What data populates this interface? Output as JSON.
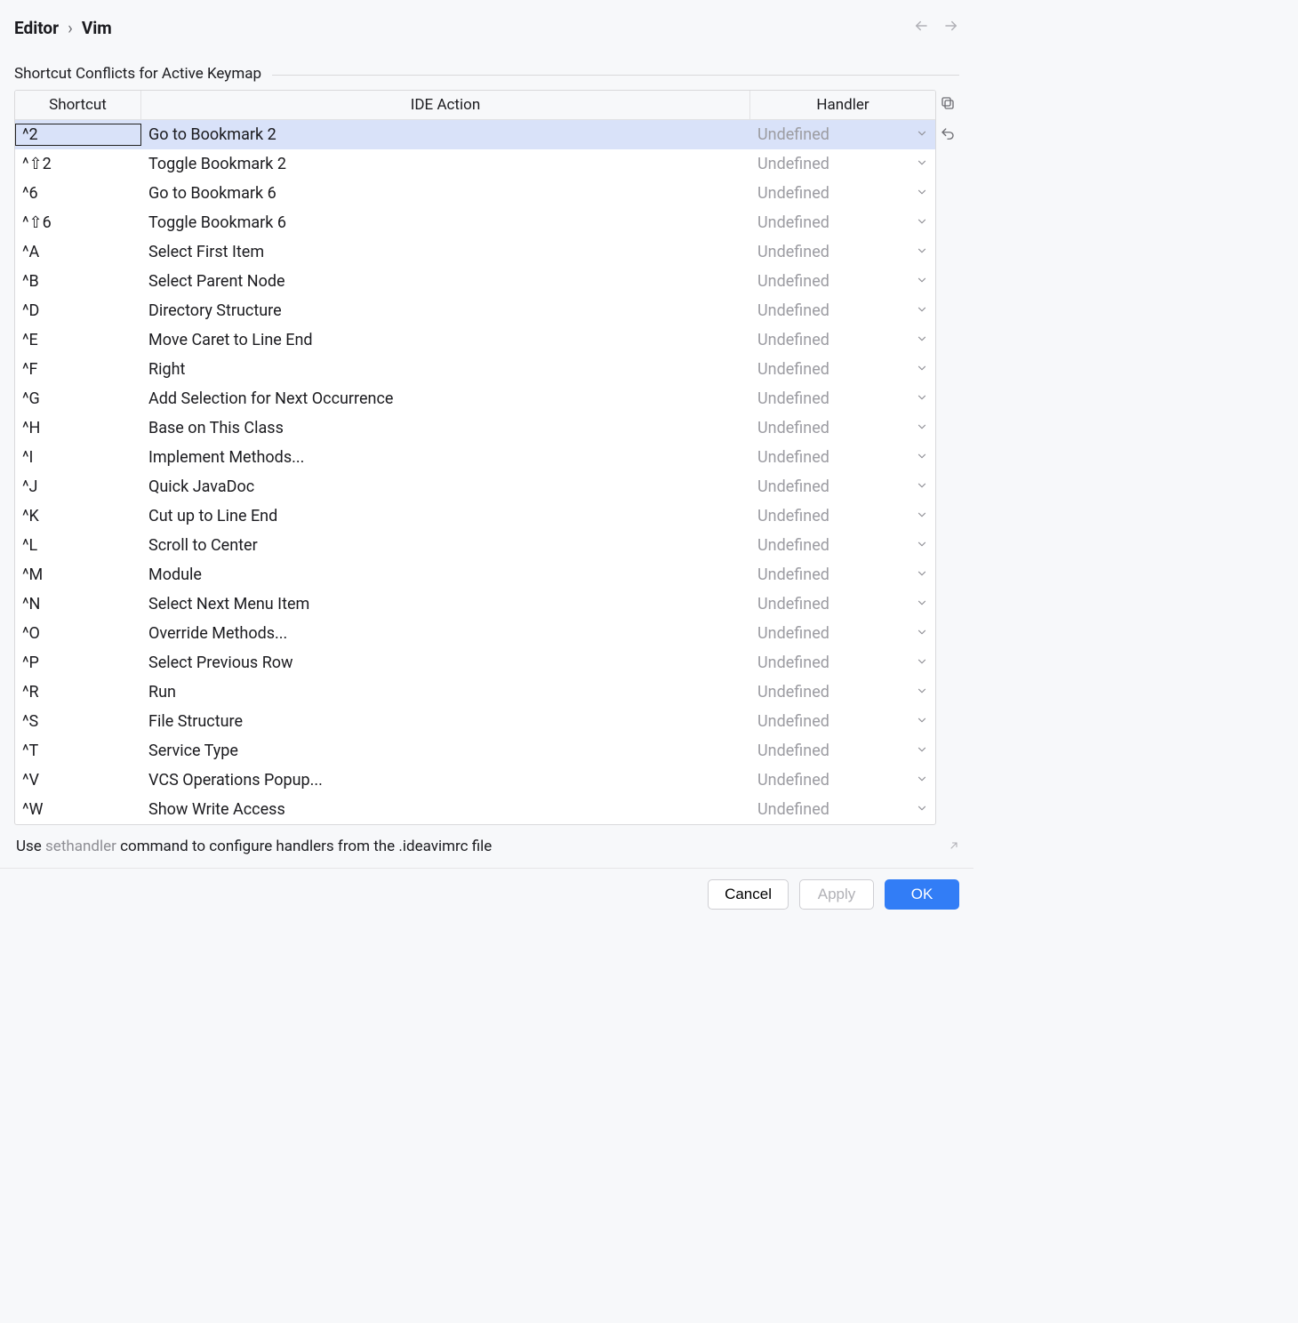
{
  "breadcrumb": {
    "parent": "Editor",
    "sep": "›",
    "current": "Vim"
  },
  "section_title": "Shortcut Conflicts for Active Keymap",
  "columns": {
    "shortcut": "Shortcut",
    "action": "IDE Action",
    "handler": "Handler"
  },
  "rows": [
    {
      "shortcut": "^2",
      "action": "Go to Bookmark 2",
      "handler": "Undefined",
      "selected": true
    },
    {
      "shortcut": "^⇧2",
      "action": "Toggle Bookmark 2",
      "handler": "Undefined",
      "selected": false
    },
    {
      "shortcut": "^6",
      "action": "Go to Bookmark 6",
      "handler": "Undefined",
      "selected": false
    },
    {
      "shortcut": "^⇧6",
      "action": "Toggle Bookmark 6",
      "handler": "Undefined",
      "selected": false
    },
    {
      "shortcut": "^A",
      "action": "Select First Item",
      "handler": "Undefined",
      "selected": false
    },
    {
      "shortcut": "^B",
      "action": "Select Parent Node",
      "handler": "Undefined",
      "selected": false
    },
    {
      "shortcut": "^D",
      "action": "Directory Structure",
      "handler": "Undefined",
      "selected": false
    },
    {
      "shortcut": "^E",
      "action": "Move Caret to Line End",
      "handler": "Undefined",
      "selected": false
    },
    {
      "shortcut": "^F",
      "action": "Right",
      "handler": "Undefined",
      "selected": false
    },
    {
      "shortcut": "^G",
      "action": "Add Selection for Next Occurrence",
      "handler": "Undefined",
      "selected": false
    },
    {
      "shortcut": "^H",
      "action": "Base on This Class",
      "handler": "Undefined",
      "selected": false
    },
    {
      "shortcut": "^I",
      "action": "Implement Methods...",
      "handler": "Undefined",
      "selected": false
    },
    {
      "shortcut": "^J",
      "action": "Quick JavaDoc",
      "handler": "Undefined",
      "selected": false
    },
    {
      "shortcut": "^K",
      "action": "Cut up to Line End",
      "handler": "Undefined",
      "selected": false
    },
    {
      "shortcut": "^L",
      "action": "Scroll to Center",
      "handler": "Undefined",
      "selected": false
    },
    {
      "shortcut": "^M",
      "action": "Module",
      "handler": "Undefined",
      "selected": false
    },
    {
      "shortcut": "^N",
      "action": "Select Next Menu Item",
      "handler": "Undefined",
      "selected": false
    },
    {
      "shortcut": "^O",
      "action": "Override Methods...",
      "handler": "Undefined",
      "selected": false
    },
    {
      "shortcut": "^P",
      "action": "Select Previous Row",
      "handler": "Undefined",
      "selected": false
    },
    {
      "shortcut": "^R",
      "action": "Run",
      "handler": "Undefined",
      "selected": false
    },
    {
      "shortcut": "^S",
      "action": "File Structure",
      "handler": "Undefined",
      "selected": false
    },
    {
      "shortcut": "^T",
      "action": "Service Type",
      "handler": "Undefined",
      "selected": false
    },
    {
      "shortcut": "^V",
      "action": "VCS Operations Popup...",
      "handler": "Undefined",
      "selected": false
    },
    {
      "shortcut": "^W",
      "action": "Show Write Access",
      "handler": "Undefined",
      "selected": false
    }
  ],
  "hint": {
    "prefix": "Use ",
    "cmd": "sethandler",
    "suffix": " command to configure handlers from the .ideavimrc file"
  },
  "buttons": {
    "cancel": "Cancel",
    "apply": "Apply",
    "ok": "OK"
  }
}
